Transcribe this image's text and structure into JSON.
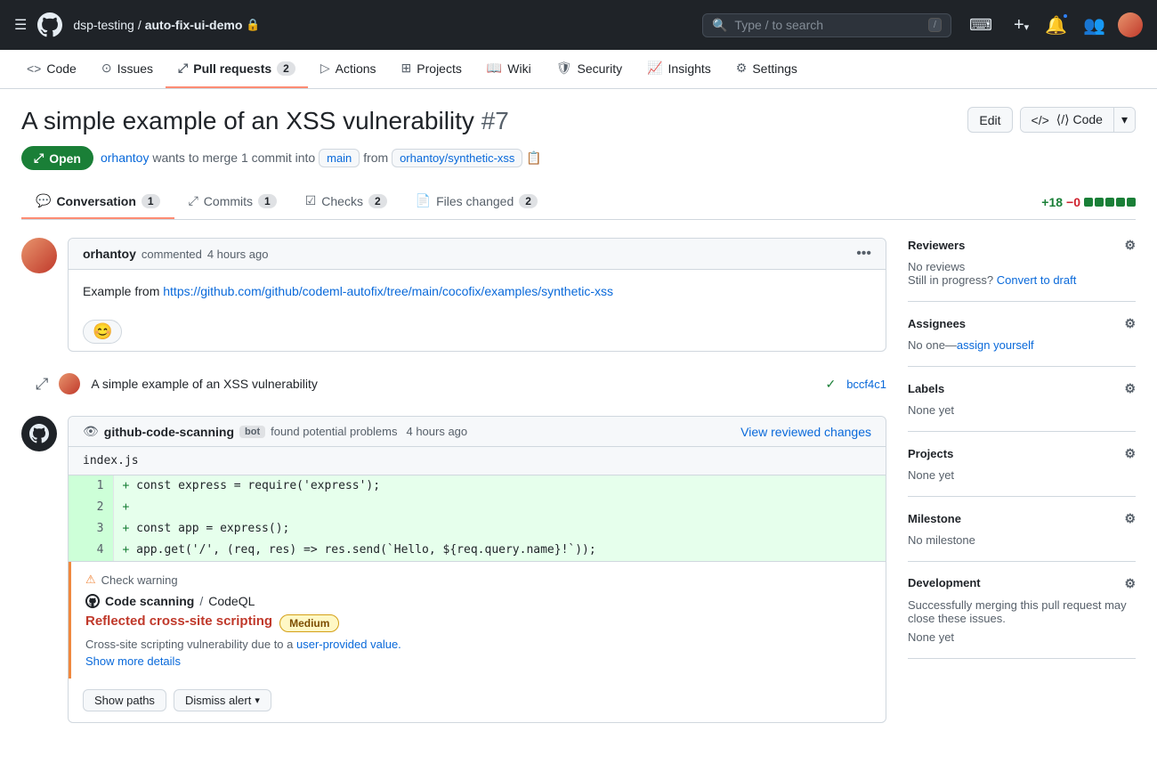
{
  "topNav": {
    "hamburger": "☰",
    "logo": "⬤",
    "breadcrumb": {
      "org": "dsp-testing",
      "sep": "/",
      "repo": "auto-fix-ui-demo",
      "lockIcon": "🔒"
    },
    "search": {
      "placeholder": "Type / to search",
      "kbd": "/"
    },
    "terminalIcon": ">_",
    "plusIcon": "+",
    "bellIcon": "🔔",
    "peopleIcon": "👥"
  },
  "repoNav": {
    "items": [
      {
        "id": "code",
        "icon": "<>",
        "label": "Code",
        "active": false
      },
      {
        "id": "issues",
        "icon": "⊙",
        "label": "Issues",
        "active": false
      },
      {
        "id": "pull-requests",
        "icon": "⤢",
        "label": "Pull requests",
        "badge": "2",
        "active": true
      },
      {
        "id": "actions",
        "icon": "▷",
        "label": "Actions",
        "active": false
      },
      {
        "id": "projects",
        "icon": "⊞",
        "label": "Projects",
        "active": false
      },
      {
        "id": "wiki",
        "icon": "📖",
        "label": "Wiki",
        "active": false
      },
      {
        "id": "security",
        "icon": "🛡",
        "label": "Security",
        "active": false
      },
      {
        "id": "insights",
        "icon": "📈",
        "label": "Insights",
        "active": false
      },
      {
        "id": "settings",
        "icon": "⚙",
        "label": "Settings",
        "active": false
      }
    ]
  },
  "pr": {
    "title": "A simple example of an XSS vulnerability",
    "number": "#7",
    "status": "Open",
    "statusIcon": "⤢",
    "author": "orhantoy",
    "action": "wants to merge",
    "commitCount": "1 commit",
    "intoLabel": "into",
    "targetBranch": "main",
    "fromLabel": "from",
    "sourceBranch": "orhantoy/synthetic-xss",
    "editLabel": "Edit",
    "codeLabel": "⟨/⟩ Code"
  },
  "tabs": {
    "conversation": {
      "label": "Conversation",
      "count": "1",
      "icon": "💬"
    },
    "commits": {
      "label": "Commits",
      "count": "1",
      "icon": "⤢"
    },
    "checks": {
      "label": "Checks",
      "count": "2",
      "icon": "☑"
    },
    "filesChanged": {
      "label": "Files changed",
      "count": "2",
      "icon": "📄"
    },
    "diffStat": "+18 −0",
    "diffAdd": "+18",
    "diffDel": "−0"
  },
  "comment": {
    "author": "orhantoy",
    "action": "commented",
    "time": "4 hours ago",
    "body": "Example from ",
    "link": "https://github.com/github/codeml-autofix/tree/main/cocofix/examples/synthetic-xss",
    "linkText": "https://github.com/github/codeml-autofix/tree/main/cocofix/examples/synthetic-xss",
    "reactionIcon": "😊"
  },
  "commitEntry": {
    "authorAvatar": "",
    "message": "A simple example of an XSS vulnerability",
    "checkIcon": "✓",
    "hash": "bccf4c1"
  },
  "codeScanBot": {
    "name": "github-code-scanning",
    "botLabel": "bot",
    "action": "found potential problems",
    "time": "4 hours ago",
    "viewChangesLabel": "View reviewed changes",
    "filename": "index.js",
    "lines": [
      {
        "num": "1",
        "content": "+ const express = require('express');"
      },
      {
        "num": "2",
        "content": "+"
      },
      {
        "num": "3",
        "content": "+ const app = express();"
      },
      {
        "num": "4",
        "content": "+ app.get('/', (req, res) => res.send(`Hello, ${req.query.name}!`));"
      }
    ],
    "warningLabel": "Check warning",
    "toolIcon": "⬤",
    "toolName": "Code scanning",
    "toolSlash": "/",
    "toolQuery": "CodeQL",
    "vulnTitle": "Reflected cross-site scripting",
    "severityLabel": "Medium",
    "vulnDesc": "Cross-site scripting vulnerability due to a ",
    "vulnLinkText": "user-provided value.",
    "showMoreLabel": "Show more details",
    "showPathsLabel": "Show paths",
    "dismissLabel": "Dismiss alert"
  },
  "sidebar": {
    "reviewers": {
      "title": "Reviewers",
      "value": "No reviews",
      "subtext": "Still in progress?",
      "linkText": "Convert to draft"
    },
    "assignees": {
      "title": "Assignees",
      "value": "No one",
      "dash": "—",
      "linkText": "assign yourself"
    },
    "labels": {
      "title": "Labels",
      "value": "None yet"
    },
    "projects": {
      "title": "Projects",
      "value": "None yet"
    },
    "milestone": {
      "title": "Milestone",
      "value": "No milestone"
    },
    "development": {
      "title": "Development",
      "desc": "Successfully merging this pull request may close these issues.",
      "value": "None yet"
    }
  }
}
